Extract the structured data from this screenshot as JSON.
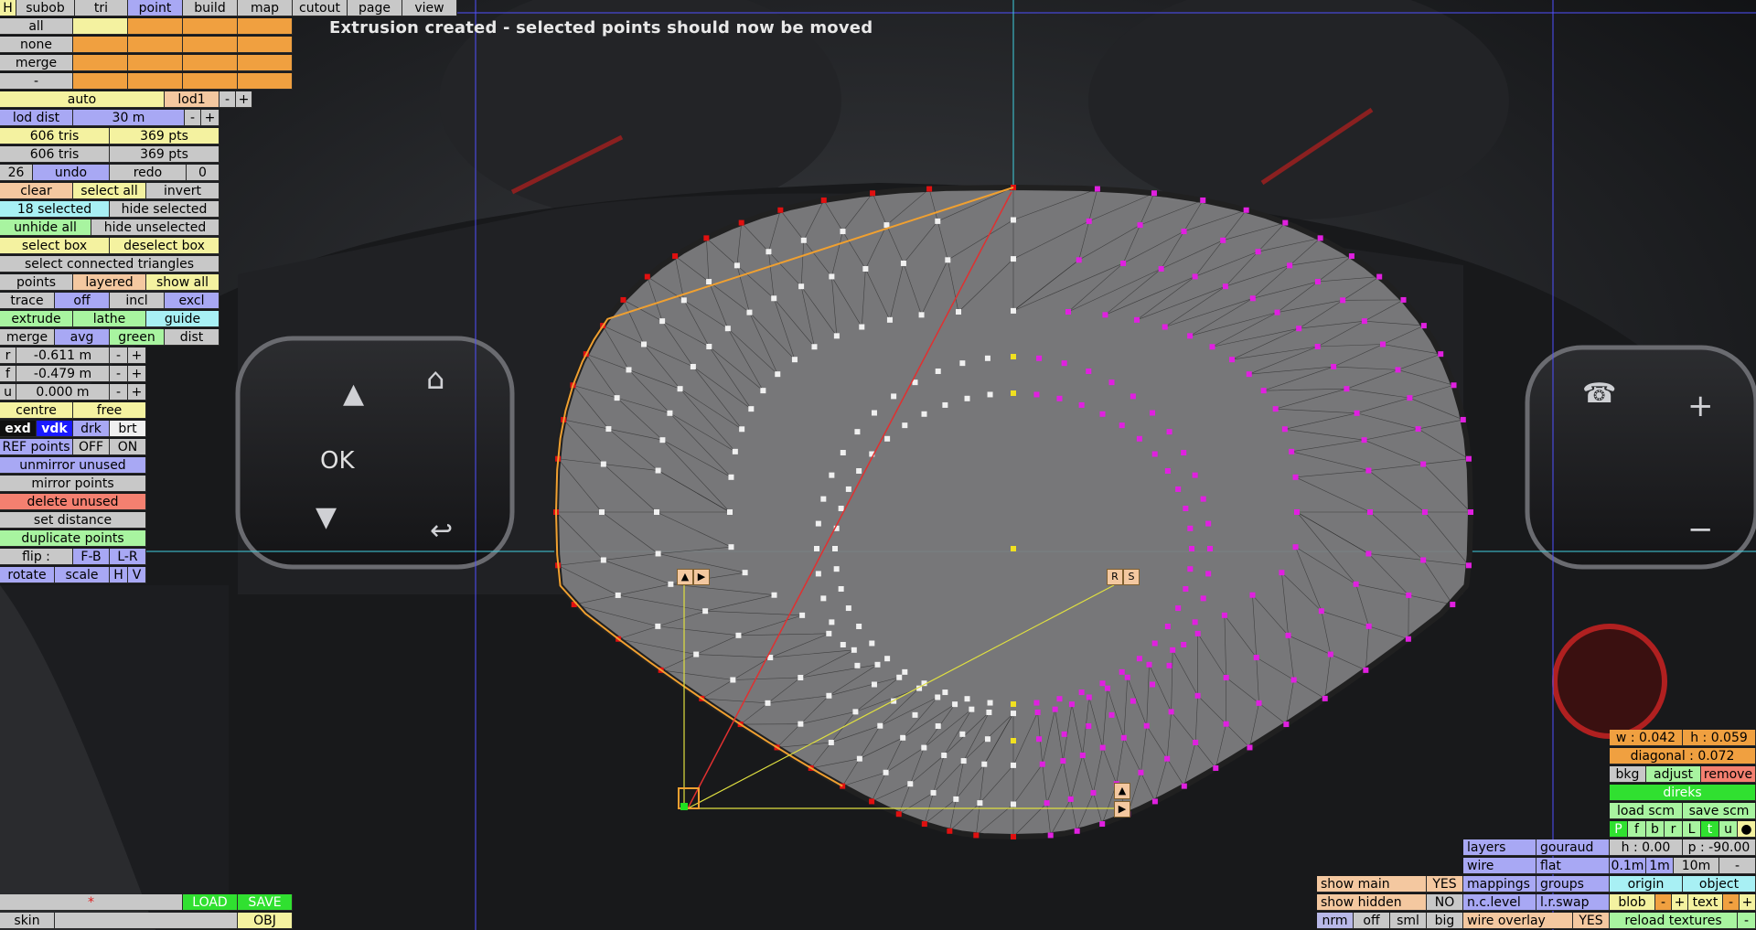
{
  "status_message": "Extrusion created - selected points should now be moved",
  "colors": {
    "panel_grey": "#c8c8c8",
    "yellow": "#f4f2a0",
    "orange": "#f0a040",
    "purple": "#a8a8f4",
    "cyan": "#a8f0f4",
    "green": "#a8f4a0",
    "peach": "#f4c8a0",
    "red": "#f48070",
    "point_magenta": "#e020e0",
    "point_red": "#e01010",
    "point_yellow": "#f0e020"
  },
  "top_tabs": {
    "h": "H",
    "subob": "subob",
    "tri": "tri",
    "point": "point",
    "build": "build",
    "map": "map",
    "cutout": "cutout",
    "page": "page",
    "view": "view"
  },
  "sel_rows": {
    "all": "all",
    "none": "none",
    "merge": "merge",
    "dash": "-"
  },
  "lod": {
    "auto": "auto",
    "lod1": "lod1",
    "minus": "-",
    "plus": "+",
    "dist_label": "lod dist",
    "dist_value": "30 m"
  },
  "counts": {
    "tris1": "606 tris",
    "pts1": "369 pts",
    "tris2": "606 tris",
    "pts2": "369 pts",
    "undo_count": "26",
    "undo": "undo",
    "redo": "redo",
    "redo_count": "0"
  },
  "selection": {
    "clear": "clear",
    "select_all": "select all",
    "invert": "invert",
    "selected": "18 selected",
    "hide_selected": "hide selected",
    "unhide_all": "unhide all",
    "hide_unselected": "hide unselected",
    "select_box": "select box",
    "deselect_box": "deselect box",
    "select_connected": "select connected triangles"
  },
  "points_row": {
    "points": "points",
    "layered": "layered",
    "show_all": "show all"
  },
  "trace_row": {
    "trace": "trace",
    "off": "off",
    "incl": "incl",
    "excl": "excl"
  },
  "extrude_row": {
    "extrude": "extrude",
    "lathe": "lathe",
    "guide": "guide"
  },
  "merge_row": {
    "merge": "merge",
    "avg": "avg",
    "green": "green",
    "dist": "dist"
  },
  "coords": {
    "r_label": "r",
    "r_value": "-0.611 m",
    "f_label": "f",
    "f_value": "-0.479 m",
    "u_label": "u",
    "u_value": "0.000 m",
    "minus": "-",
    "plus": "+"
  },
  "centre_row": {
    "centre": "centre",
    "free": "free"
  },
  "shade_row": {
    "exd": "exd",
    "vdk": "vdk",
    "drk": "drk",
    "brt": "brt"
  },
  "ref_row": {
    "ref_points": "REF points",
    "off": "OFF",
    "on": "ON"
  },
  "actions": {
    "unmirror_unused": "unmirror unused",
    "mirror_points": "mirror points",
    "delete_unused": "delete unused",
    "set_distance": "set distance",
    "duplicate_points": "duplicate points"
  },
  "flip_row": {
    "flip": "flip :",
    "fb": "F-B",
    "lr": "L-R"
  },
  "rotate_row": {
    "rotate": "rotate",
    "scale": "scale",
    "h": "H",
    "v": "V"
  },
  "bottom_left": {
    "asterisk": "*",
    "load": "LOAD",
    "save": "SAVE",
    "skin": "skin",
    "obj": "OBJ"
  },
  "handles": {
    "up": "▲",
    "right": "▶",
    "r": "R",
    "s": "S"
  },
  "right_panel": {
    "w": "w : 0.042",
    "h": "h : 0.059",
    "diagonal": "diagonal : 0.072",
    "bkg": "bkg",
    "adjust": "adjust",
    "remove": "remove",
    "direks": "direks",
    "load_scm": "load scm",
    "save_scm": "save scm",
    "views": [
      "P",
      "f",
      "b",
      "r",
      "L",
      "t",
      "u",
      "●"
    ],
    "h_val": "h : 0.00",
    "p_val": "p : -90.00",
    "layers": "layers",
    "gouraud": "gouraud",
    "wire": "wire",
    "flat": "flat",
    "tenth": "0.1m",
    "one": "1m",
    "ten": "10m",
    "dash": "-",
    "mappings": "mappings",
    "groups": "groups",
    "origin": "origin",
    "object": "object",
    "nclevel": "n.c.level",
    "lrswap": "l.r.swap",
    "blob": "blob",
    "minus": "-",
    "plus": "+",
    "text": "text",
    "nrm": "nrm",
    "off": "off",
    "sml": "sml",
    "big": "big",
    "wire_overlay": "wire overlay",
    "yes": "YES",
    "reload": "reload textures",
    "show_main": "show main",
    "show_main_val": "YES",
    "show_hidden": "show hidden",
    "show_hidden_val": "NO"
  }
}
